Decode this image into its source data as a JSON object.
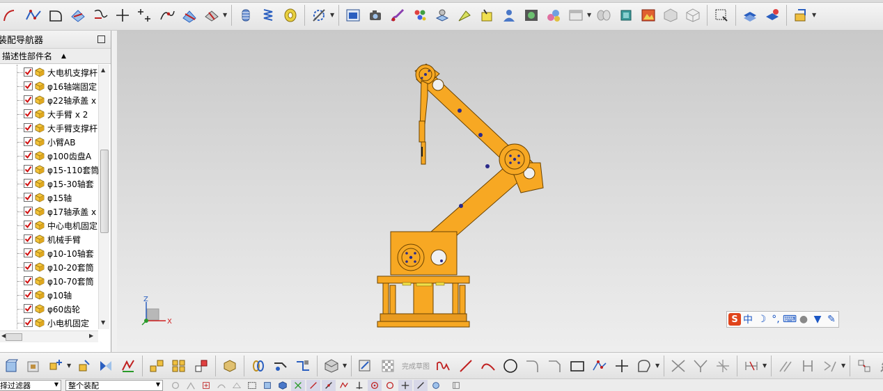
{
  "navigator": {
    "title": "装配导航器",
    "column_header": "描述性部件名",
    "items": [
      {
        "label": "大电机支撑杆",
        "checked": true
      },
      {
        "label": "φ16轴端固定",
        "checked": true
      },
      {
        "label": "φ22轴承盖 x",
        "checked": true
      },
      {
        "label": "大手臂 x 2",
        "checked": true
      },
      {
        "label": "大手臂支撑杆",
        "checked": true
      },
      {
        "label": "小臂AB",
        "checked": true
      },
      {
        "label": "φ100齿盘A",
        "checked": true
      },
      {
        "label": "φ15-110套筒",
        "checked": true
      },
      {
        "label": "φ15-30轴套",
        "checked": true
      },
      {
        "label": "φ15轴",
        "checked": true
      },
      {
        "label": "φ17轴承盖 x",
        "checked": true
      },
      {
        "label": "中心电机固定",
        "checked": true
      },
      {
        "label": "机械手臂",
        "checked": true
      },
      {
        "label": "φ10-10轴套",
        "checked": true
      },
      {
        "label": "φ10-20套筒",
        "checked": true
      },
      {
        "label": "φ10-70套筒",
        "checked": true
      },
      {
        "label": "φ10轴",
        "checked": true
      },
      {
        "label": "φ60齿轮",
        "checked": true
      },
      {
        "label": "小电机固定",
        "checked": true
      }
    ]
  },
  "triad": {
    "z_label": "Z",
    "x_label": "X"
  },
  "ime": {
    "logo": "S",
    "mode": "中"
  },
  "bottom_toolbar": {
    "finish_sketch_label": "完成草图"
  },
  "filter_bar": {
    "type_filter": "择过滤器",
    "scope": "整个装配"
  },
  "colors": {
    "model_orange": "#f7a823",
    "viewport_top": "#c9c9c9",
    "viewport_bottom": "#eeeeee"
  }
}
